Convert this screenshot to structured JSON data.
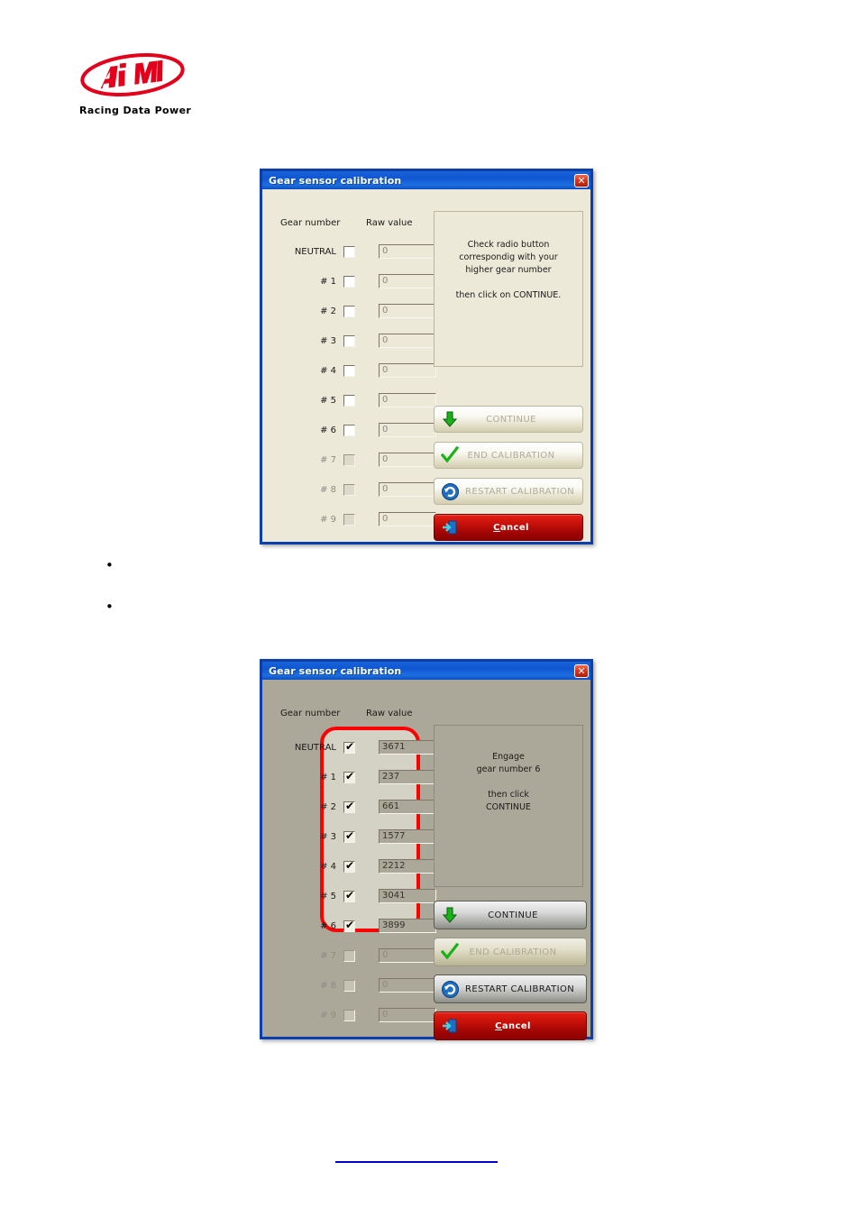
{
  "page": {
    "background_color": "#FFFFFF",
    "footer_rule_color": "#0000CC"
  },
  "logo": {
    "name": "AiM",
    "tagline": "Racing Data Power",
    "color": "#E2001A"
  },
  "bullets": [
    {
      "marker": "•",
      "text": ""
    },
    {
      "marker": "•",
      "text": ""
    }
  ],
  "dialog_top": {
    "title": "Gear sensor calibration",
    "close_label": "✕",
    "theme": "light",
    "background_color": "#ECE9D8",
    "titlebar_color": "#0E57D2",
    "headers": {
      "gear_number": "Gear number",
      "raw_value": "Raw value"
    },
    "rows": [
      {
        "label": "NEUTRAL",
        "checked": false,
        "value": "0",
        "disabled": false
      },
      {
        "label": "# 1",
        "checked": false,
        "value": "0",
        "disabled": false
      },
      {
        "label": "# 2",
        "checked": false,
        "value": "0",
        "disabled": false
      },
      {
        "label": "# 3",
        "checked": false,
        "value": "0",
        "disabled": false
      },
      {
        "label": "# 4",
        "checked": false,
        "value": "0",
        "disabled": false
      },
      {
        "label": "# 5",
        "checked": false,
        "value": "0",
        "disabled": false
      },
      {
        "label": "# 6",
        "checked": false,
        "value": "0",
        "disabled": false
      },
      {
        "label": "# 7",
        "checked": false,
        "value": "0",
        "disabled": true
      },
      {
        "label": "# 8",
        "checked": false,
        "value": "0",
        "disabled": true
      },
      {
        "label": "# 9",
        "checked": false,
        "value": "0",
        "disabled": true
      }
    ],
    "instruction": "Check radio button\ncorrespondig with your\nhigher gear number\n\nthen click on CONTINUE.",
    "buttons": {
      "continue": {
        "label": "CONTINUE",
        "icon": "green-down-arrow-icon",
        "enabled": false
      },
      "end_calibration": {
        "label": "END CALIBRATION",
        "icon": "green-check-icon",
        "enabled": false
      },
      "restart_calibration": {
        "label": "RESTART CALIBRATION",
        "icon": "blue-refresh-icon",
        "enabled": false
      },
      "cancel": {
        "label": "Cancel",
        "accel": "C",
        "icon": "exit-door-icon",
        "enabled": true
      }
    }
  },
  "dialog_bottom": {
    "title": "Gear sensor calibration",
    "close_label": "✕",
    "theme": "dark",
    "background_color": "#ACA899",
    "titlebar_color": "#0E57D2",
    "headers": {
      "gear_number": "Gear number",
      "raw_value": "Raw value"
    },
    "rows": [
      {
        "label": "NEUTRAL",
        "checked": true,
        "value": "3671",
        "disabled": false
      },
      {
        "label": "# 1",
        "checked": true,
        "value": "237",
        "disabled": false
      },
      {
        "label": "# 2",
        "checked": true,
        "value": "661",
        "disabled": false
      },
      {
        "label": "# 3",
        "checked": true,
        "value": "1577",
        "disabled": false
      },
      {
        "label": "# 4",
        "checked": true,
        "value": "2212",
        "disabled": false
      },
      {
        "label": "# 5",
        "checked": true,
        "value": "3041",
        "disabled": false
      },
      {
        "label": "# 6",
        "checked": true,
        "value": "3899",
        "disabled": false
      },
      {
        "label": "# 7",
        "checked": false,
        "value": "0",
        "disabled": true
      },
      {
        "label": "# 8",
        "checked": false,
        "value": "0",
        "disabled": true
      },
      {
        "label": "# 9",
        "checked": false,
        "value": "0",
        "disabled": true
      }
    ],
    "instruction": "Engage\ngear number 6\n\nthen click\nCONTINUE",
    "annotation": {
      "shape": "rounded-rectangle",
      "color": "#FF0000"
    },
    "buttons": {
      "continue": {
        "label": "CONTINUE",
        "icon": "green-down-arrow-icon",
        "enabled": true
      },
      "end_calibration": {
        "label": "END CALIBRATION",
        "icon": "green-check-icon",
        "enabled": false
      },
      "restart_calibration": {
        "label": "RESTART CALIBRATION",
        "icon": "blue-refresh-icon",
        "enabled": true
      },
      "cancel": {
        "label": "Cancel",
        "accel": "C",
        "icon": "exit-door-icon",
        "enabled": true
      }
    }
  }
}
